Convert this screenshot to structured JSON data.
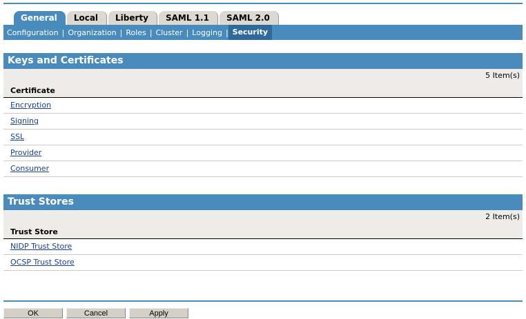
{
  "tabs": [
    "General",
    "Local",
    "Liberty",
    "SAML 1.1",
    "SAML 2.0"
  ],
  "subnav": [
    "Configuration",
    "Organization",
    "Roles",
    "Cluster",
    "Logging",
    "Security"
  ],
  "keys": {
    "title": "Keys and Certificates",
    "count": "5 Item(s)",
    "column": "Certificate",
    "rows": [
      "Encryption",
      "Signing",
      "SSL",
      "Provider",
      "Consumer"
    ]
  },
  "trust": {
    "title": "Trust Stores",
    "count": "2 Item(s)",
    "column": "Trust Store",
    "rows": [
      "NIDP Trust Store",
      "OCSP Trust Store"
    ]
  },
  "buttons": {
    "ok": "OK",
    "cancel": "Cancel",
    "apply": "Apply"
  }
}
